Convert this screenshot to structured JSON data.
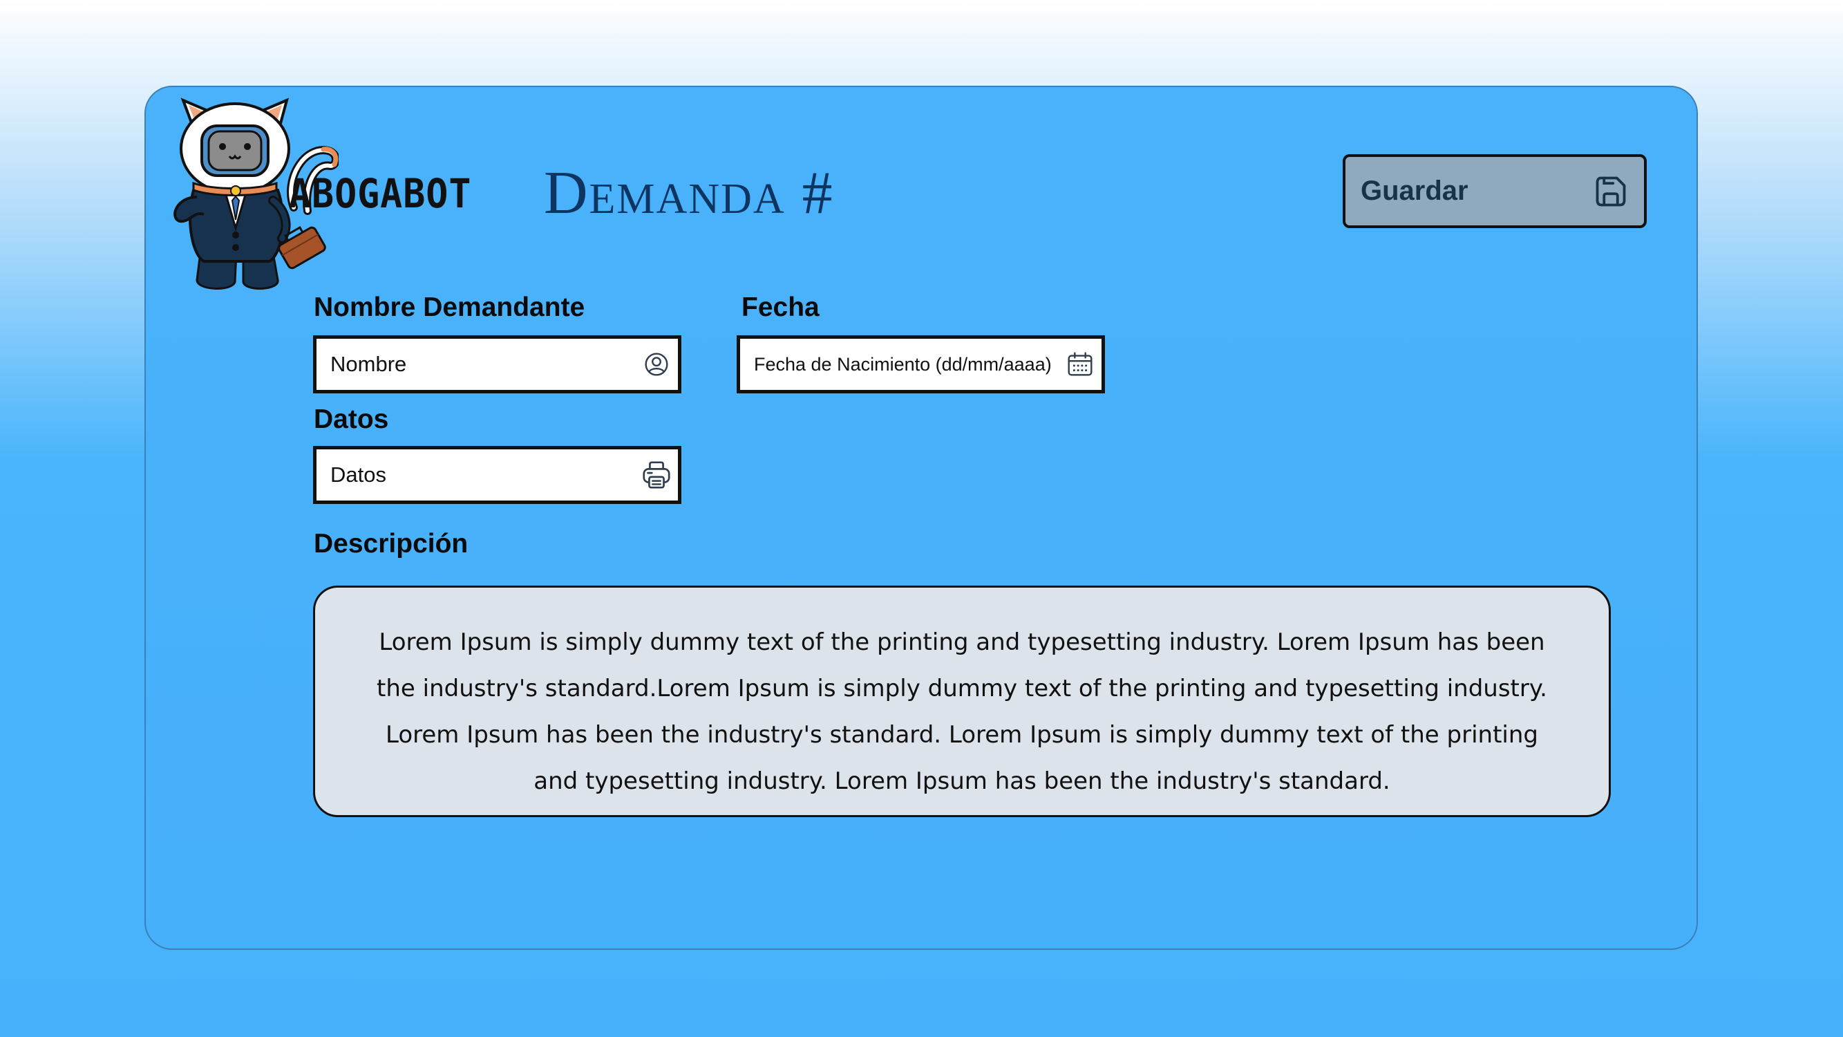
{
  "header": {
    "brand": "ABOGABOT",
    "page_title": "Demanda #",
    "save_label": "Guardar"
  },
  "form": {
    "nombre": {
      "label": "Nombre Demandante",
      "value": "Nombre"
    },
    "fecha": {
      "label": "Fecha",
      "value": "Fecha de Nacimiento (dd/mm/aaaa)"
    },
    "datos": {
      "label": "Datos",
      "value": "Datos"
    },
    "descripcion": {
      "label": "Descripción",
      "text": "Lorem Ipsum is simply dummy text of the printing and typesetting industry. Lorem Ipsum has been the industry's standard.Lorem Ipsum is simply dummy text of the printing and typesetting industry. Lorem Ipsum has been the industry's standard. Lorem Ipsum is simply dummy text of the printing and typesetting industry. Lorem Ipsum has been the industry's standard."
    }
  },
  "icons": {
    "save": "save-icon",
    "nombre": "user-circle-icon",
    "fecha": "calendar-icon",
    "datos": "printer-icon",
    "logo": "cat-lawyer-mascot"
  },
  "colors": {
    "card_background": "#47b0fb",
    "title": "#0e3562",
    "save_button": "#8faabe",
    "description_background": "#dde3ea"
  }
}
